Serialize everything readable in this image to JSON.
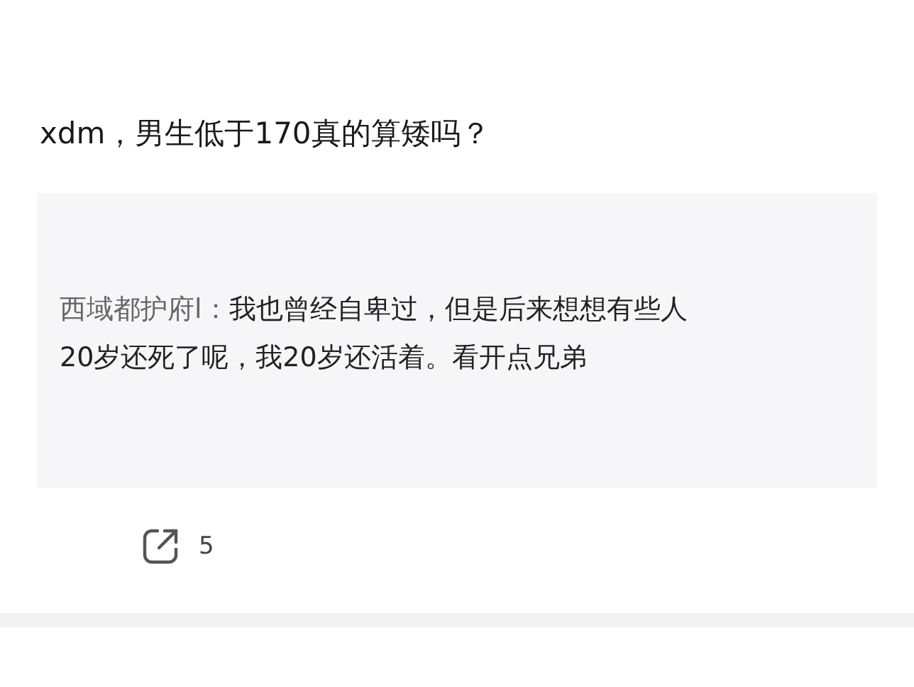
{
  "post": {
    "title": "xdm，男生低于170真的算矮吗？",
    "quote": {
      "author": "西域都护府l：",
      "text": "我也曾经自卑过，但是后来想想有些人20岁还死了呢，我20岁还活着。看开点兄弟"
    },
    "share_count": "5"
  }
}
